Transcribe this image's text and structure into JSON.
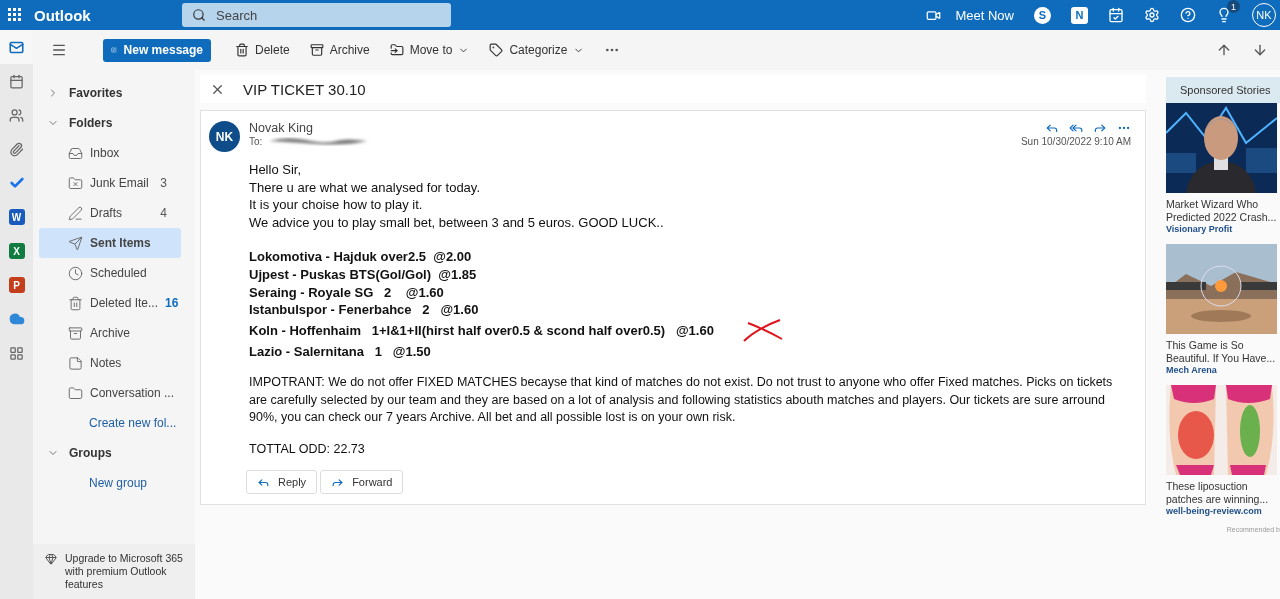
{
  "top_bar": {
    "app_name": "Outlook",
    "search_placeholder": "Search",
    "meet_now": "Meet Now",
    "skype_letter": "S",
    "onenote_letter": "N",
    "tips_badge": "1",
    "avatar": "NK"
  },
  "rail": [
    {
      "kind": "mail",
      "selected": true
    },
    {
      "kind": "calendar",
      "selected": false
    },
    {
      "kind": "people",
      "selected": false
    },
    {
      "kind": "files",
      "selected": false
    },
    {
      "kind": "todo",
      "selected": false
    },
    {
      "kind": "office",
      "letter": "W",
      "color": "#185abd",
      "selected": false
    },
    {
      "kind": "office",
      "letter": "X",
      "color": "#107c41",
      "selected": false
    },
    {
      "kind": "office",
      "letter": "P",
      "color": "#c43e1c",
      "selected": false
    },
    {
      "kind": "onedrive",
      "selected": false
    },
    {
      "kind": "apps",
      "selected": false
    }
  ],
  "toolbar": {
    "new_message": "New message",
    "actions": [
      {
        "kind": "delete",
        "label": "Delete",
        "dropdown": false
      },
      {
        "kind": "archive",
        "label": "Archive",
        "dropdown": false
      },
      {
        "kind": "move",
        "label": "Move to",
        "dropdown": true
      },
      {
        "kind": "categorize",
        "label": "Categorize",
        "dropdown": true
      }
    ]
  },
  "nav": {
    "sections": [
      {
        "label": "Favorites",
        "expanded": false
      },
      {
        "label": "Folders",
        "expanded": true,
        "link": "Create new fol...",
        "items": [
          {
            "kind": "inbox",
            "label": "Inbox",
            "selected": false
          },
          {
            "kind": "junk",
            "label": "Junk Email",
            "count": "3",
            "unread": false,
            "selected": false
          },
          {
            "kind": "drafts",
            "label": "Drafts",
            "count": "4",
            "unread": false,
            "selected": false
          },
          {
            "kind": "sent",
            "label": "Sent Items",
            "selected": true
          },
          {
            "kind": "scheduled",
            "label": "Scheduled",
            "selected": false
          },
          {
            "kind": "deleted",
            "label": "Deleted Ite...",
            "count": "16",
            "unread": true,
            "selected": false
          },
          {
            "kind": "archive",
            "label": "Archive",
            "selected": false
          },
          {
            "kind": "notes",
            "label": "Notes",
            "selected": false
          },
          {
            "kind": "folder",
            "label": "Conversation ...",
            "selected": false
          }
        ]
      },
      {
        "label": "Groups",
        "expanded": true,
        "link": "New group"
      }
    ],
    "upgrade": "Upgrade to Microsoft 365 with premium Outlook features"
  },
  "message": {
    "subject": "VIP TICKET 30.10",
    "sender": "Novak King",
    "initials": "NK",
    "to_label": "To:",
    "date": "Sun 10/30/2022 9:10 AM",
    "greeting": [
      "Hello Sir,",
      "There u are what we analysed for today.",
      "It is your choise how to play it.",
      "We advice you to play small bet, between 3 and 5 euros. GOOD LUCK.."
    ],
    "picks": [
      {
        "text": "Lokomotiva - Hajduk over2.5  @2.00",
        "crossed": false
      },
      {
        "text": "Ujpest - Puskas BTS(Gol/Gol)  @1.85",
        "crossed": false
      },
      {
        "text": "Seraing - Royale SG   2    @1.60",
        "crossed": false
      },
      {
        "text": "Istanbulspor - Fenerbahce   2   @1.60",
        "crossed": false
      },
      {
        "text": "Koln - Hoffenhaim   1+I&1+II(hirst half over0.5 & scond half over0.5)   @1.60",
        "crossed": true
      },
      {
        "text": "Lazio - Salernitana   1   @1.50",
        "crossed": false
      }
    ],
    "notice": "IMPOTRANT: We do not offer FIXED MATCHES becayse that kind of matches do not exist. Do not trust to anyone who offer Fixed matches. Picks on tickets are carefully selected by our team and they are based on a lot of analysis and following statistics abouth matches and players. Our tickets are sure arround 90%, you can check our 7 years Archive. All bet and all possible lost is on your own risk.",
    "total": "TOTTAL ODD: 22.73",
    "buttons": [
      {
        "kind": "reply",
        "label": "Reply"
      },
      {
        "kind": "forward",
        "label": "Forward"
      }
    ]
  },
  "ads": {
    "title": "Sponsored Stories",
    "items": [
      {
        "kind": "finance",
        "headline": "Market Wizard Who Predicted 2022 Crash...",
        "source": "Visionary Profit"
      },
      {
        "kind": "game",
        "headline": "This Game is So Beautiful. If You Have...",
        "source": "Mech Arena"
      },
      {
        "kind": "body",
        "headline": "These liposuction patches are winning...",
        "source": "well-being-review.com"
      }
    ],
    "footer": "Recommended b"
  }
}
